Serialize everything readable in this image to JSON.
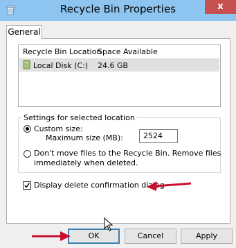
{
  "window": {
    "title": "Recycle Bin Properties",
    "close_label": "x"
  },
  "tabs": [
    {
      "label": "General"
    }
  ],
  "list": {
    "headers": [
      "Recycle Bin Location",
      "Space Available"
    ],
    "rows": [
      {
        "location": "Local Disk (C:)",
        "space": "24.6 GB"
      }
    ]
  },
  "settings": {
    "group_label": "Settings for selected location",
    "custom_size_label": "Custom size:",
    "max_size_label": "Maximum size (MB):",
    "max_size_value": "2524",
    "no_move_label_line1": "Don't move files to the Recycle Bin. Remove files",
    "no_move_label_line2": "immediately when deleted.",
    "custom_size_selected": true
  },
  "confirm_checkbox": {
    "label": "Display delete confirmation dialog",
    "checked": true
  },
  "buttons": {
    "ok": "OK",
    "cancel": "Cancel",
    "apply": "Apply"
  },
  "colors": {
    "titlebar": "#8ec5f0",
    "close": "#c75050",
    "annotation_arrow": "#c8102e"
  }
}
